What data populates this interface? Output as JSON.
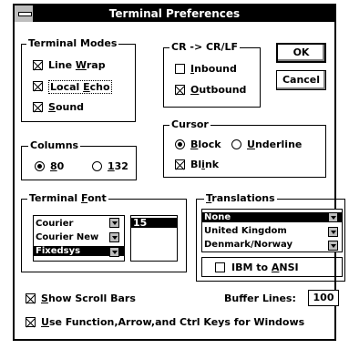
{
  "window": {
    "title": "Terminal Preferences"
  },
  "terminal_modes": {
    "legend": "Terminal Modes",
    "line_wrap": {
      "pre": "Line ",
      "u": "W",
      "post": "rap",
      "checked": true
    },
    "local_echo": {
      "pre": "Local ",
      "u": "E",
      "post": "cho",
      "checked": true
    },
    "sound": {
      "pre": "",
      "u": "S",
      "post": "ound",
      "checked": true
    }
  },
  "cr_lf": {
    "legend": "CR -> CR/LF",
    "inbound": {
      "pre": "",
      "u": "I",
      "post": "nbound",
      "checked": false
    },
    "outbound": {
      "pre": "",
      "u": "O",
      "post": "utbound",
      "checked": true
    }
  },
  "buttons": {
    "ok": "OK",
    "cancel": "Cancel"
  },
  "columns": {
    "legend": "Columns",
    "opt80": {
      "pre": "",
      "u": "8",
      "post": "0",
      "selected": true
    },
    "opt132": {
      "pre": "",
      "u": "1",
      "post": "32",
      "selected": false
    }
  },
  "cursor": {
    "legend": "Cursor",
    "block": {
      "pre": "",
      "u": "B",
      "post": "lock",
      "selected": true
    },
    "underline": {
      "pre": "",
      "u": "U",
      "post": "nderline",
      "selected": false
    },
    "blink": {
      "pre": "Bl",
      "u": "i",
      "post": "nk",
      "checked": true
    }
  },
  "terminal_font": {
    "legend_pre": "Terminal ",
    "legend_u": "F",
    "legend_post": "ont",
    "fonts": [
      "Courier",
      "Courier New",
      "Fixedsys"
    ],
    "selected_font_index": 2,
    "size": "15"
  },
  "translations": {
    "legend_pre": "",
    "legend_u": "T",
    "legend_post": "ranslations",
    "items": [
      "None",
      "United Kingdom",
      "Denmark/Norway"
    ],
    "selected_index": 0,
    "ibm_to_ansi": {
      "pre": "IBM to ",
      "u": "A",
      "post": "NSI",
      "checked": false
    }
  },
  "scroll_bars": {
    "pre": "",
    "u": "S",
    "post": "how Scroll Bars",
    "checked": true
  },
  "buffer_lines": {
    "label": "Buffer Lines:",
    "value": "100"
  },
  "function_keys": {
    "pre": "",
    "u": "U",
    "post": "se Function,Arrow,and Ctrl Keys for Windows",
    "checked": true
  }
}
